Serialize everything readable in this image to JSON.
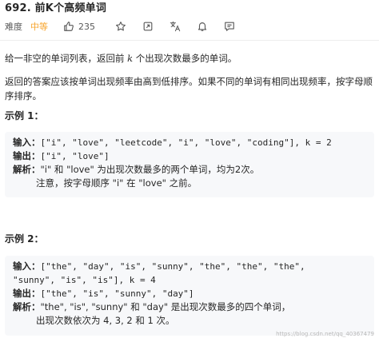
{
  "problem": {
    "title": "692. 前K个高频单词",
    "difficulty_label": "难度",
    "difficulty": "中等",
    "likes": "235",
    "accent_color": "#f7a630"
  },
  "icons": [
    "thumbs-up-icon",
    "star-icon",
    "share-icon",
    "translate-icon",
    "bell-icon",
    "comment-icon"
  ],
  "description": {
    "p1_before": "给一非空的单词列表，返回前 ",
    "p1_k": "k",
    "p1_after": " 个出现次数最多的单词。",
    "p2": "返回的答案应该按单词出现频率由高到低排序。如果不同的单词有相同出现频率，按字母顺序排序。"
  },
  "example1": {
    "title": "示例 1：",
    "input_label": "输入：",
    "input_value": "[\"i\", \"love\", \"leetcode\", \"i\", \"love\", \"coding\"], k = 2",
    "output_label": "输出：",
    "output_value": "[\"i\", \"love\"]",
    "explain_label": "解析：",
    "explain_value": "\"i\" 和 \"love\" 为出现次数最多的两个单词，均为2次。",
    "note": "注意，按字母顺序 \"i\" 在 \"love\" 之前。"
  },
  "example2": {
    "title": "示例 2：",
    "input_label": "输入：",
    "input_value_line1": "[\"the\", \"day\", \"is\", \"sunny\", \"the\", \"the\", \"the\",",
    "input_value_line2": "\"sunny\", \"is\", \"is\"], k = 4",
    "output_label": "输出：",
    "output_value": "[\"the\", \"is\", \"sunny\", \"day\"]",
    "explain_label": "解析：",
    "explain_value": "\"the\", \"is\", \"sunny\" 和 \"day\" 是出现次数最多的四个单词，",
    "note": "出现次数依次为 4, 3, 2 和 1 次。"
  },
  "watermark": "https://blog.csdn.net/qq_40367479"
}
